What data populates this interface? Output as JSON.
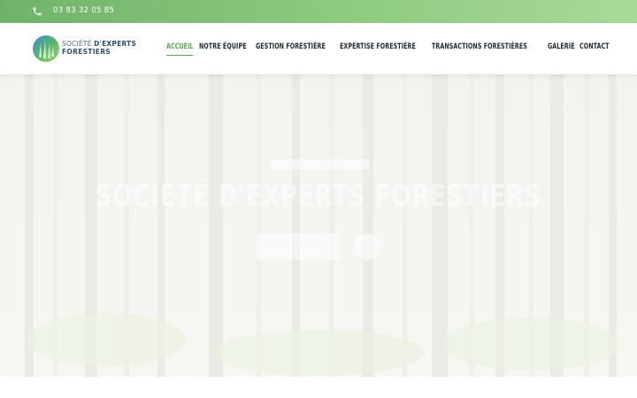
{
  "topbar": {
    "phone_icon": "phone-icon",
    "phone": "03 83 32 05 85",
    "gradient_start": "#6fb36a",
    "gradient_end": "#a9d99a"
  },
  "header": {
    "logo_icon": "forest-logo-icon",
    "logo_line1_a": "SOCIÉTÉ ",
    "logo_line1_b": "D'EXPERTS",
    "logo_line2": "FORESTIERS",
    "nav": [
      {
        "label": "ACCUEIL",
        "active": true
      },
      {
        "label": "NOTRE ÉQUIPE",
        "active": false
      },
      {
        "label": "GESTION FORESTIÈRE",
        "active": false
      },
      {
        "label": "EXPERTISE FORESTIÈRE",
        "active": false
      },
      {
        "label": "TRANSACTIONS FORESTIÈRES",
        "active": false
      },
      {
        "label": "GALERIE",
        "active": false
      },
      {
        "label": "CONTACT",
        "active": false
      }
    ],
    "accent_color": "#5aa653"
  },
  "hero": {
    "title": "SOCIÉTÉ D'EXPERTS FORESTIERS",
    "background": "misty-forest",
    "play_icon": "play-icon"
  }
}
